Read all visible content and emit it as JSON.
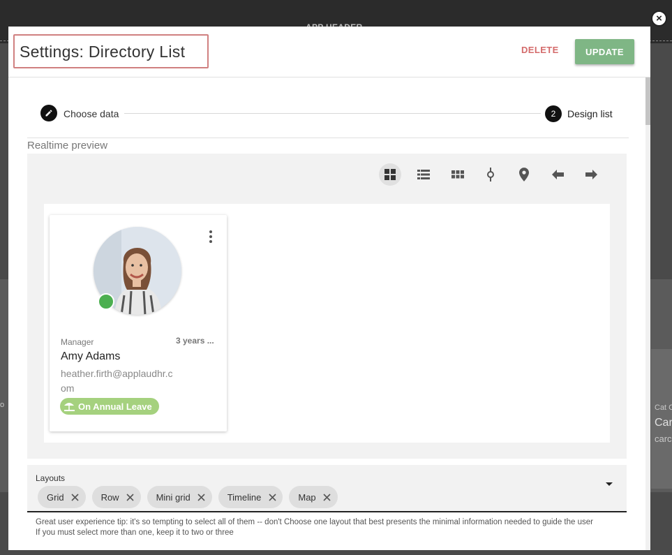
{
  "background": {
    "app_header": "APP HEADER",
    "right_card": {
      "small": "Cat C",
      "big": "Car",
      "text": "carc"
    },
    "left_text": "o"
  },
  "modal": {
    "title": "Settings: Directory List",
    "delete_label": "DELETE",
    "update_label": "UPDATE",
    "close_icon": "×"
  },
  "stepper": {
    "step1": {
      "icon": "pencil-icon",
      "label": "Choose data"
    },
    "step2": {
      "number": "2",
      "label": "Design list"
    }
  },
  "preview": {
    "label": "Realtime preview",
    "toolbar": [
      {
        "name": "grid-view-icon",
        "active": true
      },
      {
        "name": "list-view-icon",
        "active": false
      },
      {
        "name": "mini-grid-icon",
        "active": false
      },
      {
        "name": "timeline-icon",
        "active": false
      },
      {
        "name": "map-pin-icon",
        "active": false
      },
      {
        "name": "arrow-left-icon",
        "active": false
      },
      {
        "name": "arrow-right-icon",
        "active": false
      }
    ],
    "card": {
      "role": "Manager",
      "tenure": "3 years ...",
      "name": "Amy Adams",
      "email": "heather.firth@applaudhr.com",
      "status_color": "#4caf50",
      "badge": "On Annual Leave",
      "badge_color": "#a5d17e"
    }
  },
  "layouts": {
    "label": "Layouts",
    "chips": [
      "Grid",
      "Row",
      "Mini grid",
      "Timeline",
      "Map"
    ],
    "helper_line1": "Great user experience tip: it's so tempting to select all of them -- don't Choose one layout that best presents the minimal information needed to guide the user",
    "helper_line2": "If you must select more than one, keep it to two or three"
  },
  "colors": {
    "accent_update": "#7fb685",
    "delete": "#d46b6b",
    "title_outline": "#d08080"
  }
}
